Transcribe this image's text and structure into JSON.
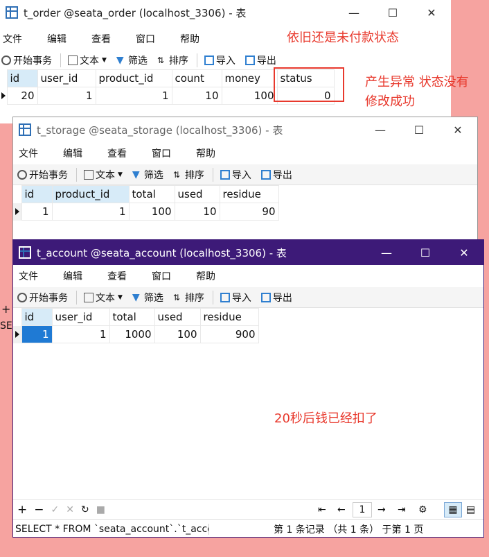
{
  "menu": {
    "file": "文件",
    "edit": "编辑",
    "view": "查看",
    "window": "窗口",
    "help": "帮助"
  },
  "toolbar": {
    "begin_tx": "开始事务",
    "text": "文本",
    "filter": "筛选",
    "sort": "排序",
    "import": "导入",
    "export": "导出"
  },
  "win_buttons": {
    "min": "—",
    "max": "☐",
    "close": "✕"
  },
  "order": {
    "title": "t_order @seata_order (localhost_3306) - 表",
    "columns": [
      "id",
      "user_id",
      "product_id",
      "count",
      "money",
      "status"
    ],
    "row": [
      "20",
      "1",
      "1",
      "10",
      "100",
      "0"
    ]
  },
  "storage": {
    "title": "t_storage @seata_storage (localhost_3306) - 表",
    "columns": [
      "id",
      "product_id",
      "total",
      "used",
      "residue"
    ],
    "row": [
      "1",
      "1",
      "100",
      "10",
      "90"
    ]
  },
  "account": {
    "title": "t_account @seata_account (localhost_3306) - 表",
    "columns": [
      "id",
      "user_id",
      "total",
      "used",
      "residue"
    ],
    "row": [
      "1",
      "1",
      "1000",
      "100",
      "900"
    ],
    "page_number": "1",
    "sql": "SELECT * FROM `seata_account`.`t_acco",
    "record_info": "第 1 条记录 （共 1 条） 于第 1 页"
  },
  "annotations": {
    "a1": "依旧还是未付款状态",
    "a2": "产生异常 状态没有",
    "a3": "修改成功",
    "a4": "20秒后钱已经扣了"
  },
  "bg_partial": {
    "plus": "+",
    "sel": "SE"
  },
  "colors": {
    "accent_title": "#3d1a78",
    "annotation": "#e8392d",
    "selected_cell": "#1f7ad4",
    "header_selected": "#d7ebf8"
  }
}
